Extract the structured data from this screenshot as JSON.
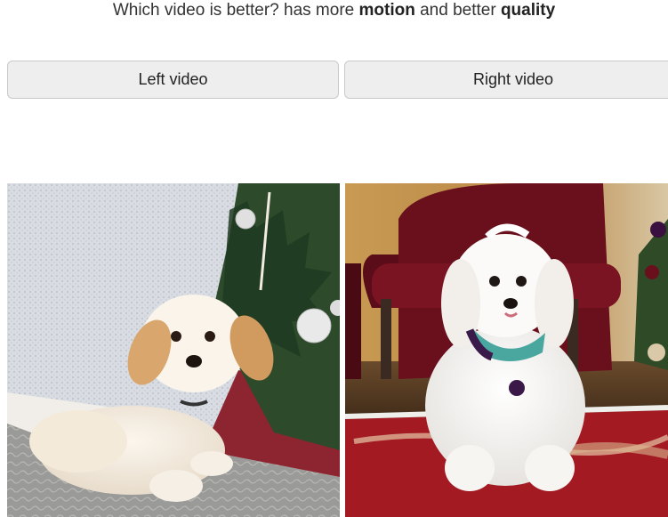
{
  "question": {
    "prefix": "Which video is better? has more ",
    "term1": "motion",
    "middle": " and better ",
    "term2": "quality"
  },
  "buttons": {
    "left_label": "Left video",
    "right_label": "Right video"
  },
  "videos": {
    "left": {
      "subject": "puppy-by-christmas-tree"
    },
    "right": {
      "subject": "white-dog-on-red-rug"
    }
  }
}
